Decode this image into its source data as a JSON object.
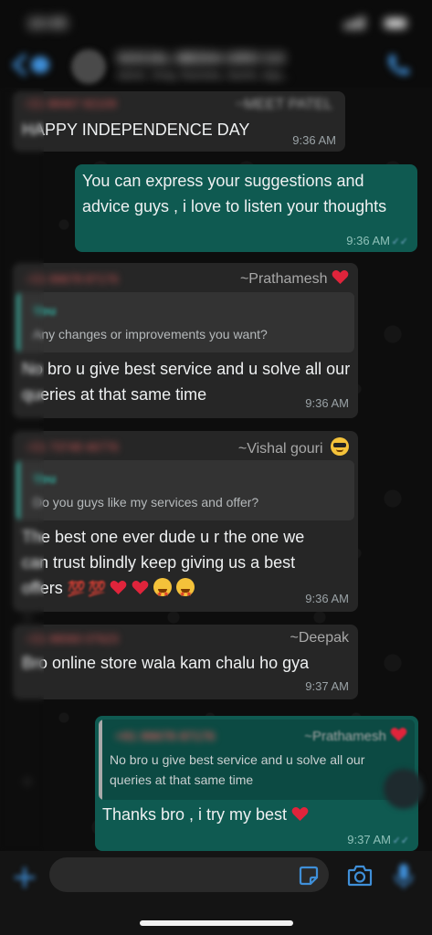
{
  "status_bar": {
    "time": "10:05",
    "icons": "signal wifi battery"
  },
  "header": {
    "group_name": "SOCIAL MEDIA GRO 3.0",
    "members": "Admin, Vinay, Ravindra, Sachin, Ajay..."
  },
  "messages": [
    {
      "sender_phone": "+91 98467 82109",
      "sender_name": "~MEET PATEL",
      "text": "HAPPY INDEPENDENCE DAY",
      "time": "9:36 AM"
    },
    {
      "text": "You can express your suggestions and advice guys , i love to listen your thoughts",
      "time": "9:36 AM"
    },
    {
      "sender_phone": "+91 99678 87176",
      "sender_name": "~Prathamesh",
      "quote_author": "You",
      "quote_text": "Any changes or improvements you want?",
      "text": "No bro u give best service and u solve all our queries at that same time",
      "time": "9:36 AM"
    },
    {
      "sender_phone": "+91 73748 46776",
      "sender_name": "~Vishal gouri",
      "quote_author": "You",
      "quote_text": "Do you guys like my services and offer?",
      "text_line1": "The best one ever dude u r the one we",
      "text_line2": "can trust blindly keep giving us a best",
      "text_line3": "offers",
      "emoji_line": "💯 💯",
      "time": "9:36 AM"
    },
    {
      "sender_phone": "+91 98060 07623",
      "sender_name": "~Deepak",
      "text": "Bro online store wala kam chalu ho gya",
      "time": "9:37 AM"
    },
    {
      "quote_author": "+91 99678 87176",
      "quote_name": "~Prathamesh",
      "quote_line1": "No bro u give best service and u solve all our",
      "quote_line2": "queries at that same time",
      "text": "Thanks bro , i try my best",
      "time": "9:37 AM"
    }
  ],
  "composer": {
    "placeholder": ""
  },
  "colors": {
    "incoming": "#262626",
    "outgoing": "#0f5a51",
    "accent": "#2fae9f",
    "heart": "#e0243b"
  }
}
